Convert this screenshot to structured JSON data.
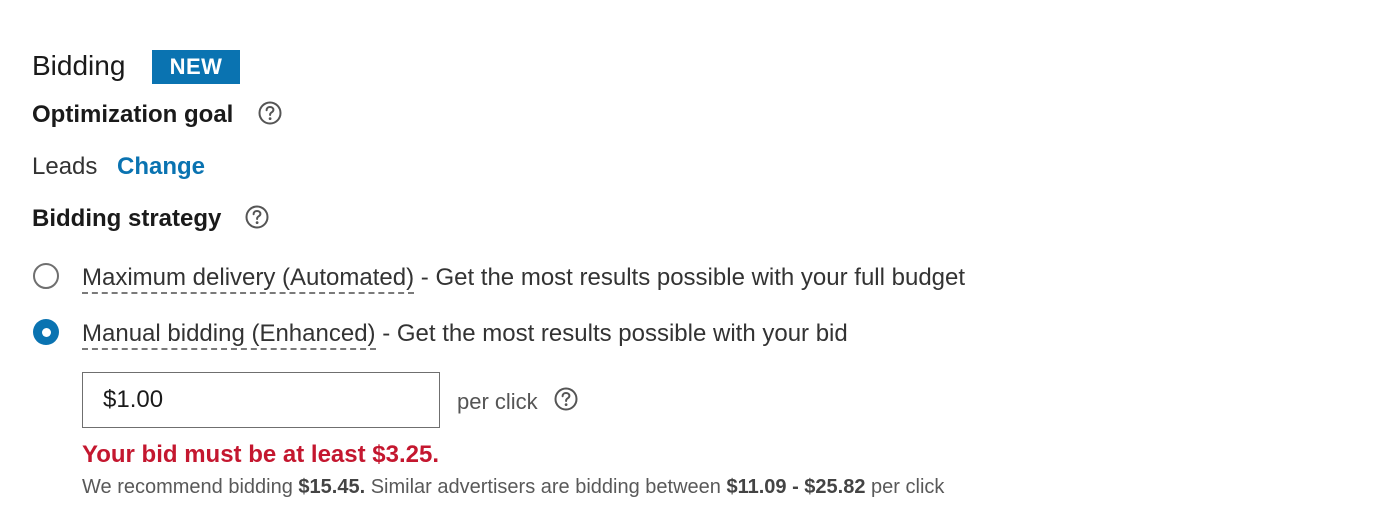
{
  "bidding": {
    "title": "Bidding",
    "badge": "NEW"
  },
  "optimization": {
    "label": "Optimization goal",
    "value": "Leads",
    "change_label": "Change"
  },
  "strategy": {
    "label": "Bidding strategy",
    "options": [
      {
        "name": "Maximum delivery (Automated)",
        "description": "- Get the most results possible with your full budget",
        "selected": false
      },
      {
        "name": "Manual bidding (Enhanced)",
        "description": "- Get the most results possible with your bid",
        "selected": true
      }
    ]
  },
  "bid": {
    "value": "$1.00",
    "unit": "per click",
    "error": "Your bid must be at least $3.25.",
    "recommend_prefix": "We recommend bidding",
    "recommended_amount": "$15.45.",
    "similar_text": "Similar advertisers are bidding between",
    "range": "$11.09 - $25.82",
    "recommend_suffix": "per click"
  },
  "icons": {
    "help": "help-circle-icon"
  },
  "colors": {
    "accent": "#0a73b1",
    "error": "#c4172f"
  }
}
